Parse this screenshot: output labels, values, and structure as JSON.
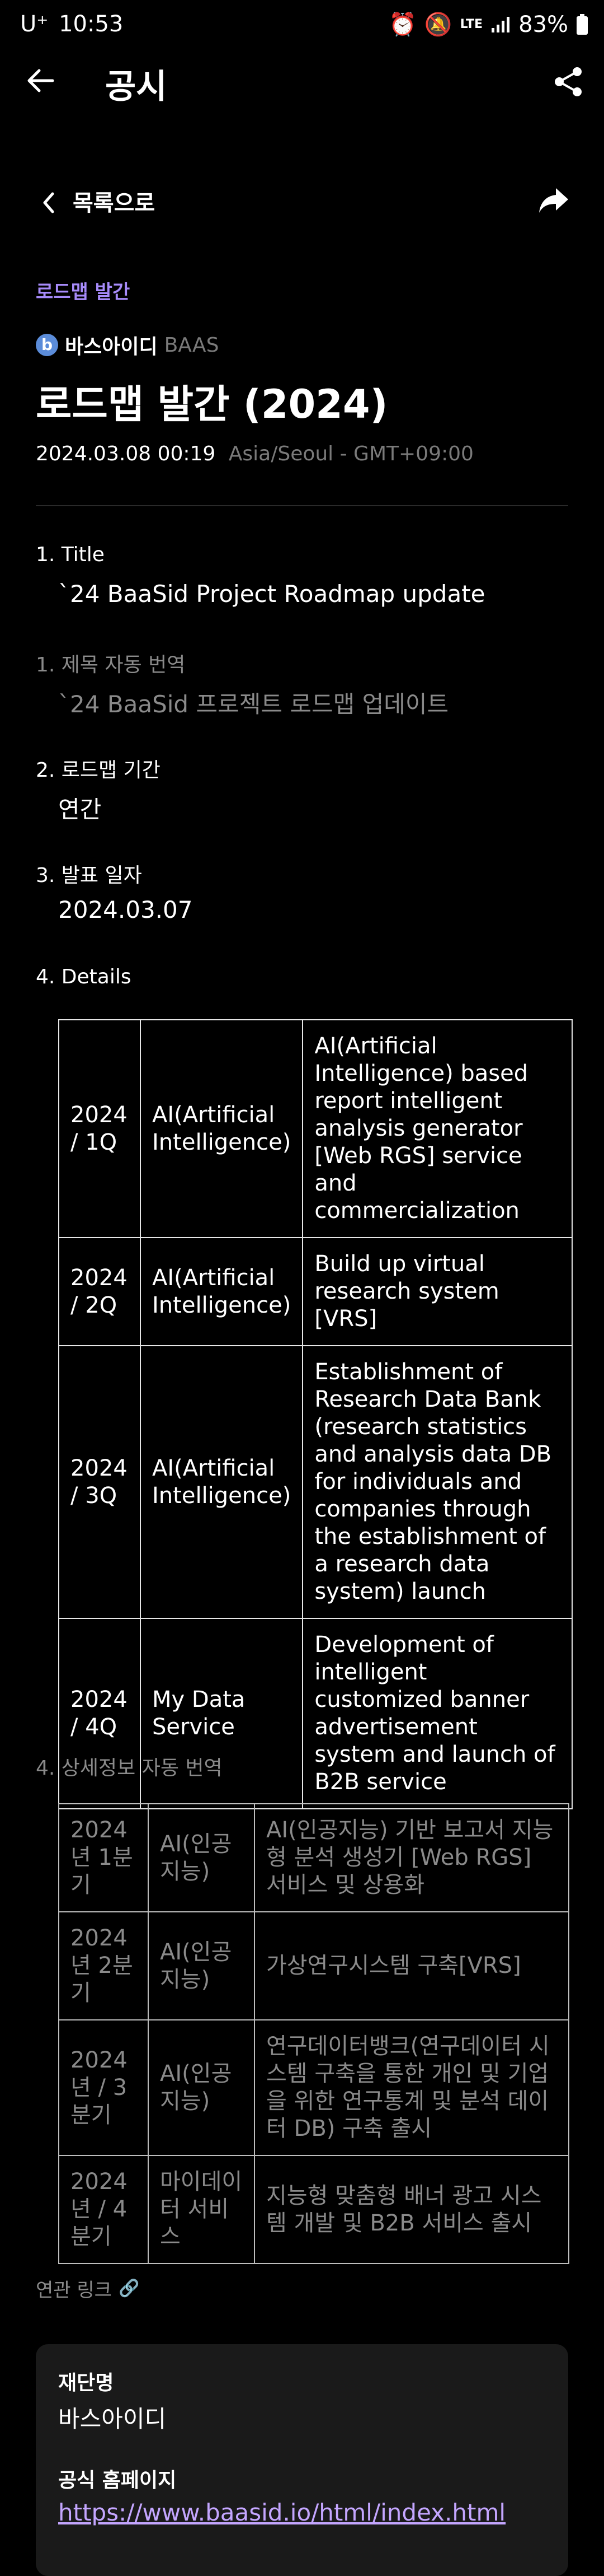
{
  "status_bar": {
    "carrier": "U⁺",
    "time": "10:53",
    "lte": "LTE",
    "battery": "83%"
  },
  "app_bar": {
    "title": "공시"
  },
  "list_nav": {
    "label": "목록으로"
  },
  "post": {
    "category": "로드맵 발간",
    "issuer_name": "바스아이디",
    "issuer_symbol": "BAAS",
    "title": "로드맵 발간 (2024)",
    "datetime": "2024.03.08 00:19",
    "timezone": "Asia/Seoul - GMT+09:00"
  },
  "fields": {
    "title_label": "1. Title",
    "title_value": "`24 BaaSid Project Roadmap update",
    "title_tr_label": "1. 제목 자동 번역",
    "title_tr_value": "`24 BaaSid 프로젝트 로드맵 업데이트",
    "period_label": "2. 로드맵 기간",
    "period_value": "연간",
    "date_label": "3. 발표 일자",
    "date_value": "2024.03.07",
    "details_label": "4. Details",
    "details_tr_label": "4. 상세정보 자동 번역"
  },
  "details_rows": [
    {
      "quarter": "2024 / 1Q",
      "area": "AI(Artificial Intelligence)",
      "desc": "AI(Artificial Intelligence) based report intelligent analysis generator [Web RGS] service and commercialization"
    },
    {
      "quarter": "2024 / 2Q",
      "area": "AI(Artificial Intelligence)",
      "desc": "Build up virtual research system [VRS]"
    },
    {
      "quarter": "2024 / 3Q",
      "area": "AI(Artificial Intelligence)",
      "desc": "Establishment of Research Data Bank (research statistics and analysis data DB for individuals and companies through the establishment of a research data system) launch"
    },
    {
      "quarter": "2024 / 4Q",
      "area": "My Data Service",
      "desc": "Development of intelligent customized banner advertisement system and launch of B2B service"
    }
  ],
  "details_tr_rows": [
    {
      "quarter": "2024년 1분기",
      "area": "AI(인공지능)",
      "desc": "AI(인공지능) 기반 보고서 지능형 분석 생성기 [Web RGS] 서비스 및 상용화"
    },
    {
      "quarter": "2024년 2분기",
      "area": "AI(인공지능)",
      "desc": "가상연구시스템 구축[VRS]"
    },
    {
      "quarter": "2024년 / 3분기",
      "area": "AI(인공지능)",
      "desc": "연구데이터뱅크(연구데이터 시스템 구축을 통한 개인 및 기업을 위한 연구통계 및 분석 데이터 DB) 구축 출시"
    },
    {
      "quarter": "2024년 / 4분기",
      "area": "마이데이터 서비스",
      "desc": "지능형 맞춤형 배너 광고 시스템 개발 및 B2B 서비스 출시"
    }
  ],
  "related": {
    "label": "연관 링크"
  },
  "foundation": {
    "name_label": "재단명",
    "name_value": "바스아이디",
    "homepage_label": "공식 홈페이지",
    "homepage_value": "https://www.baasid.io/html/index.html"
  },
  "colors": {
    "accent": "#a78bfa",
    "link": "#c4a6ff",
    "card_bg": "#1a1a1a",
    "muted": "#8a8a8a"
  }
}
